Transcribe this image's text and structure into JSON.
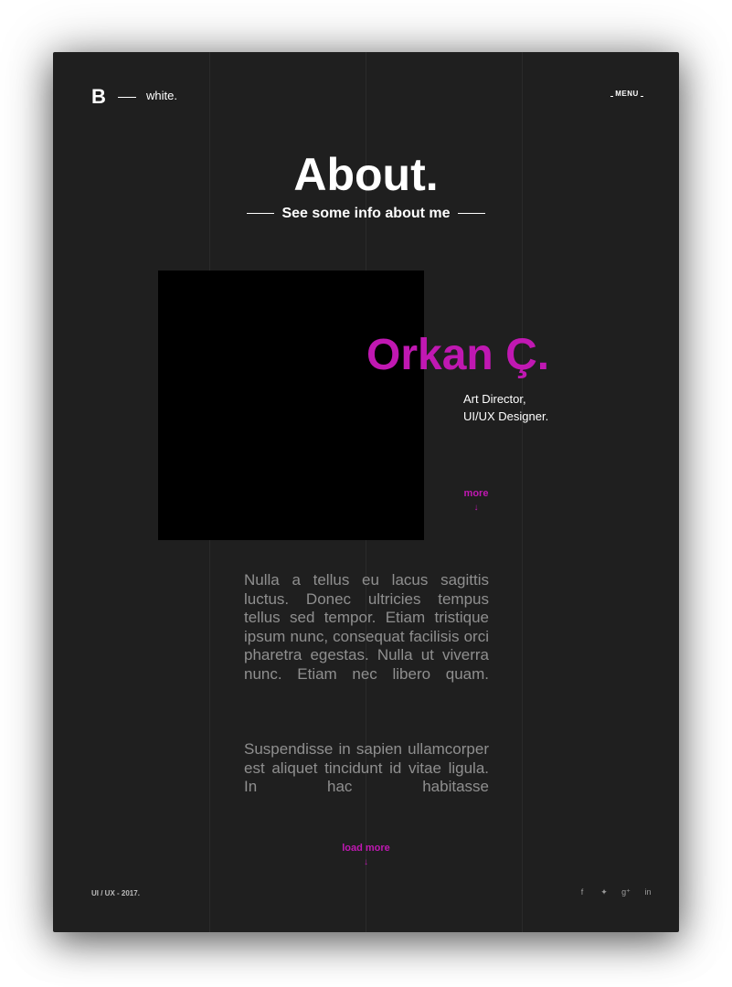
{
  "header": {
    "logo_mark": "B",
    "logo_text": "white.",
    "menu_label": "MENU"
  },
  "hero": {
    "title": "About.",
    "subtitle": "See some info about me"
  },
  "profile": {
    "name": "Orkan Ç.",
    "role_line1": "Art Director,",
    "role_line2": "UI/UX Designer.",
    "more_label": "more",
    "more_arrow": "↓"
  },
  "content": {
    "paragraph1": "Nulla a tellus eu lacus sagittis luctus. Donec ultricies tempus tellus sed tempor. Etiam tris­tique ipsum nunc, consequat facilisis orci pharetra egestas. Nulla ut viverra nunc. Etiam nec libero quam.",
    "paragraph2": "Suspendisse in sapien ullam­corper est aliquet tincidunt id vitae ligula. In hac habitasse"
  },
  "actions": {
    "load_more_label": "load more",
    "load_more_arrow": "↓"
  },
  "footer": {
    "text": "UI / UX  - 2017.",
    "socials": [
      {
        "icon": "facebook-icon",
        "glyph": "f"
      },
      {
        "icon": "twitter-icon",
        "glyph": "✦"
      },
      {
        "icon": "google-plus-icon",
        "glyph": "g⁺"
      },
      {
        "icon": "linkedin-icon",
        "glyph": "in"
      }
    ]
  },
  "colors": {
    "background": "#1f1f1f",
    "accent": "#c018b2",
    "text": "#ffffff",
    "body_text": "#8f8f8f"
  }
}
